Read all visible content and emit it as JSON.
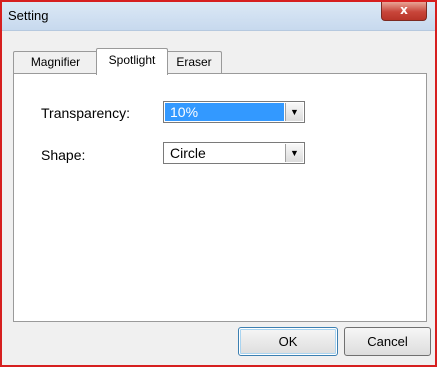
{
  "window": {
    "title": "Setting",
    "close_glyph": "x"
  },
  "tabs": [
    {
      "label": "Magnifier",
      "active": false
    },
    {
      "label": "Spotlight",
      "active": true
    },
    {
      "label": "Eraser",
      "active": false
    }
  ],
  "spotlight": {
    "transparency_label": "Transparency:",
    "transparency_value": "10%",
    "shape_label": "Shape:",
    "shape_value": "Circle",
    "dropdown_arrow": "▼"
  },
  "buttons": {
    "ok": "OK",
    "cancel": "Cancel"
  },
  "colors": {
    "window_border": "#d61f1f",
    "selection": "#3399ff",
    "close_button": "#c8453a"
  }
}
